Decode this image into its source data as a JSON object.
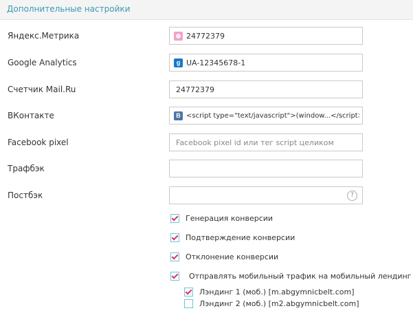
{
  "header": {
    "title": "Дополнительные настройки"
  },
  "fields": {
    "yandex": {
      "label": "Яндекс.Метрика",
      "value": "24772379",
      "icon": "yandex-metrika-icon"
    },
    "google": {
      "label": "Google Analytics",
      "value": "UA-12345678-1",
      "icon": "google-icon",
      "icon_glyph": "g"
    },
    "mailru": {
      "label": "Счетчик Mail.Ru",
      "value": "24772379"
    },
    "vk": {
      "label": "ВКонтакте",
      "value": "<script type=\"text/javascript\">(window...</script>",
      "icon": "vk-icon",
      "icon_glyph": "B"
    },
    "facebook": {
      "label": "Facebook pixel",
      "value": "",
      "placeholder": "Facebook pixel id или тег script целиком"
    },
    "trafback": {
      "label": "Трафбэк",
      "value": ""
    },
    "postback": {
      "label": "Постбэк",
      "value": "",
      "help_glyph": "?"
    }
  },
  "options": [
    {
      "label": "Генерация конверсии",
      "checked": true
    },
    {
      "label": "Подтверждение конверсии",
      "checked": true
    },
    {
      "label": "Отклонение конверсии",
      "checked": true
    },
    {
      "label": "Отправлять мобильный трафик на мобильный лендинг",
      "checked": true
    }
  ],
  "landings": [
    {
      "label": "Лэндинг 1 (моб.) [m.abgymnicbelt.com]",
      "checked": true
    },
    {
      "label": "Лэндинг 2 (моб.) [m2.abgymnicbelt.com]",
      "checked": false
    }
  ],
  "colors": {
    "accent": "#3a9ab0",
    "check": "#d6336c",
    "checkbox_border": "#6bc7d4"
  }
}
